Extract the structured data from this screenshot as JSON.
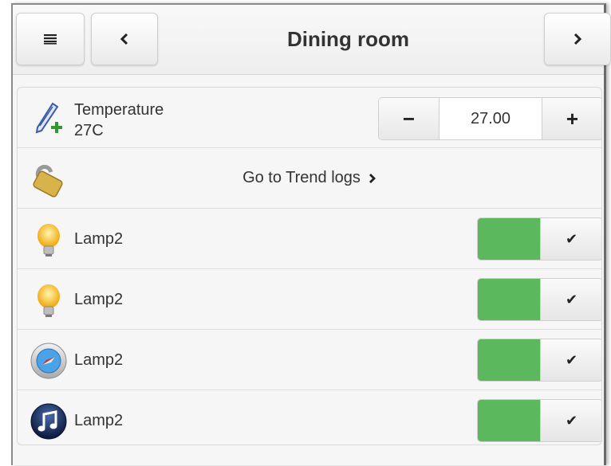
{
  "header": {
    "title": "Dining room",
    "menu_icon": "menu-icon",
    "back_icon": "chevron-left-icon",
    "next_icon": "chevron-right-icon"
  },
  "temperature": {
    "label": "Temperature",
    "value_text": "27C",
    "stepper_value": "27.00",
    "minus_label": "−",
    "plus_label": "+",
    "icon": "thermometer-plus-icon"
  },
  "trend": {
    "label": "Go to Trend logs",
    "icon": "padlock-icon",
    "chevron": "›"
  },
  "lamps": [
    {
      "label": "Lamp2",
      "icon": "lightbulb-icon",
      "state": true
    },
    {
      "label": "Lamp2",
      "icon": "lightbulb-icon",
      "state": true
    },
    {
      "label": "Lamp2",
      "icon": "compass-icon",
      "state": true
    },
    {
      "label": "Lamp2",
      "icon": "music-note-icon",
      "state": true
    }
  ],
  "toggle_check": "✔",
  "colors": {
    "toggle_on": "#5cb85c",
    "background": "#f6f6f6"
  }
}
